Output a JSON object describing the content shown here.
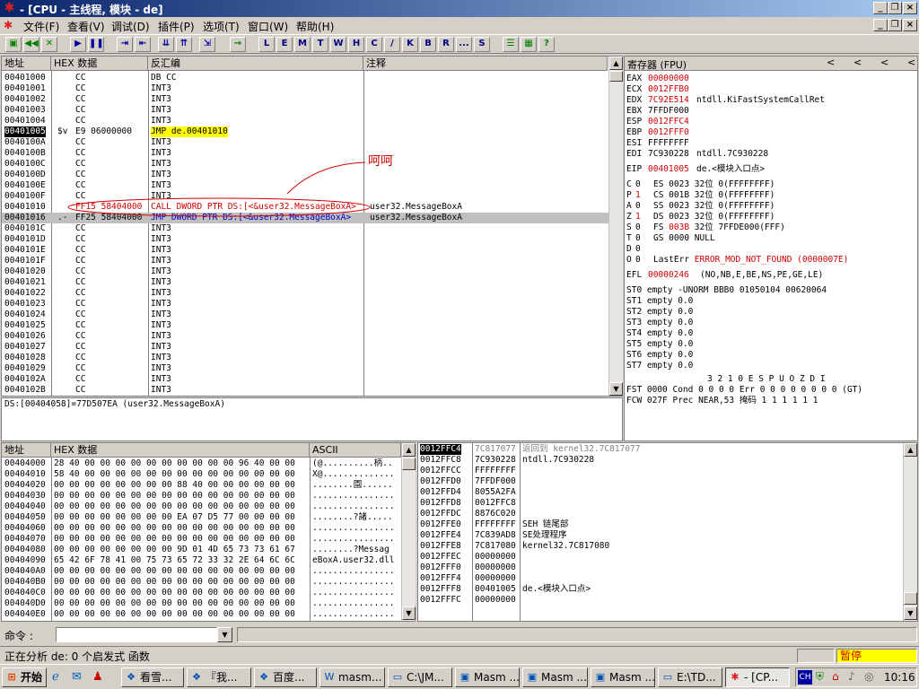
{
  "title": "- [CPU - 主线程, 模块 - de]",
  "menu": [
    "文件(F)",
    "查看(V)",
    "调试(D)",
    "插件(P)",
    "选项(T)",
    "窗口(W)",
    "帮助(H)"
  ],
  "toolbar_letters": [
    "L",
    "E",
    "M",
    "T",
    "W",
    "H",
    "C",
    "/",
    "K",
    "B",
    "R",
    "...",
    "S"
  ],
  "disasm": {
    "headers": [
      "地址",
      "HEX 数据",
      "反汇编",
      "注释"
    ],
    "rows": [
      {
        "addr": "00401000",
        "hex": "CC",
        "asm": "DB CC",
        "cmt": ""
      },
      {
        "addr": "00401001",
        "hex": "CC",
        "asm": "INT3",
        "cmt": ""
      },
      {
        "addr": "00401002",
        "hex": "CC",
        "asm": "INT3",
        "cmt": ""
      },
      {
        "addr": "00401003",
        "hex": "CC",
        "asm": "INT3",
        "cmt": ""
      },
      {
        "addr": "00401004",
        "hex": "CC",
        "asm": "INT3",
        "cmt": ""
      },
      {
        "addr": "00401005",
        "mark": "$v",
        "hex": "E9 06000000",
        "asm": "JMP de.00401010",
        "cmt": ""
      },
      {
        "addr": "0040100A",
        "hex": "CC",
        "asm": "INT3",
        "cmt": ""
      },
      {
        "addr": "0040100B",
        "hex": "CC",
        "asm": "INT3",
        "cmt": ""
      },
      {
        "addr": "0040100C",
        "hex": "CC",
        "asm": "INT3",
        "cmt": ""
      },
      {
        "addr": "0040100D",
        "hex": "CC",
        "asm": "INT3",
        "cmt": ""
      },
      {
        "addr": "0040100E",
        "hex": "CC",
        "asm": "INT3",
        "cmt": ""
      },
      {
        "addr": "0040100F",
        "hex": "CC",
        "asm": "INT3",
        "cmt": ""
      },
      {
        "addr": "00401010",
        "hex": "FF15 58404000",
        "asm": "CALL DWORD PTR DS:[<&user32.MessageBoxA>",
        "cmt": "user32.MessageBoxA"
      },
      {
        "addr": "00401016",
        "mark": ".-",
        "hex": "FF25 58404000",
        "asm": "JMP DWORD PTR DS:[<&user32.MessageBoxA>",
        "cmt": "user32.MessageBoxA"
      },
      {
        "addr": "0040101C",
        "hex": "CC",
        "asm": "INT3",
        "cmt": ""
      },
      {
        "addr": "0040101D",
        "hex": "CC",
        "asm": "INT3",
        "cmt": ""
      },
      {
        "addr": "0040101E",
        "hex": "CC",
        "asm": "INT3",
        "cmt": ""
      },
      {
        "addr": "0040101F",
        "hex": "CC",
        "asm": "INT3",
        "cmt": ""
      },
      {
        "addr": "00401020",
        "hex": "CC",
        "asm": "INT3",
        "cmt": ""
      },
      {
        "addr": "00401021",
        "hex": "CC",
        "asm": "INT3",
        "cmt": ""
      },
      {
        "addr": "00401022",
        "hex": "CC",
        "asm": "INT3",
        "cmt": ""
      },
      {
        "addr": "00401023",
        "hex": "CC",
        "asm": "INT3",
        "cmt": ""
      },
      {
        "addr": "00401024",
        "hex": "CC",
        "asm": "INT3",
        "cmt": ""
      },
      {
        "addr": "00401025",
        "hex": "CC",
        "asm": "INT3",
        "cmt": ""
      },
      {
        "addr": "00401026",
        "hex": "CC",
        "asm": "INT3",
        "cmt": ""
      },
      {
        "addr": "00401027",
        "hex": "CC",
        "asm": "INT3",
        "cmt": ""
      },
      {
        "addr": "00401028",
        "hex": "CC",
        "asm": "INT3",
        "cmt": ""
      },
      {
        "addr": "00401029",
        "hex": "CC",
        "asm": "INT3",
        "cmt": ""
      },
      {
        "addr": "0040102A",
        "hex": "CC",
        "asm": "INT3",
        "cmt": ""
      },
      {
        "addr": "0040102B",
        "hex": "CC",
        "asm": "INT3",
        "cmt": ""
      }
    ],
    "annotation": "呵呵",
    "info_line": "DS:[00404058]=77D507EA (user32.MessageBoxA)"
  },
  "registers": {
    "header": "寄存器 (FPU)",
    "nav": [
      "<",
      "<",
      "<",
      "<"
    ],
    "lines": [
      {
        "name": "EAX",
        "value": "00000000",
        "comment": "",
        "red": true
      },
      {
        "name": "ECX",
        "value": "0012FFB0",
        "comment": "",
        "red": true
      },
      {
        "name": "EDX",
        "value": "7C92E514",
        "comment": "ntdll.KiFastSystemCallRet",
        "red": true
      },
      {
        "name": "EBX",
        "value": "7FFDF000",
        "comment": "",
        "red": false
      },
      {
        "name": "ESP",
        "value": "0012FFC4",
        "comment": "",
        "red": true
      },
      {
        "name": "EBP",
        "value": "0012FFF0",
        "comment": "",
        "red": true
      },
      {
        "name": "ESI",
        "value": "FFFFFFFF",
        "comment": "",
        "red": false
      },
      {
        "name": "EDI",
        "value": "7C930228",
        "comment": "ntdll.7C930228",
        "red": false
      }
    ],
    "eip": {
      "name": "EIP",
      "value": "00401005",
      "comment": "de.<模块入口点>"
    },
    "flags": [
      {
        "f": "C",
        "v": "0",
        "seg": "ES 0023 32位 0(FFFFFFFF)",
        "red": false
      },
      {
        "f": "P",
        "v": "1",
        "seg": "CS 001B 32位 0(FFFFFFFF)",
        "red": true
      },
      {
        "f": "A",
        "v": "0",
        "seg": "SS 0023 32位 0(FFFFFFFF)",
        "red": false
      },
      {
        "f": "Z",
        "v": "1",
        "seg": "DS 0023 32位 0(FFFFFFFF)",
        "red": true
      },
      {
        "f": "S",
        "v": "0",
        "seg": "FS 003B 32位 7FFDE000(FFF)",
        "red": false
      },
      {
        "f": "T",
        "v": "0",
        "seg": "GS 0000 NULL",
        "red": false
      },
      {
        "f": "D",
        "v": "0",
        "seg": "",
        "red": false
      },
      {
        "f": "O",
        "v": "0",
        "seg": "LastErr ERROR_MOD_NOT_FOUND (0000007E)",
        "red": false
      }
    ],
    "efl": {
      "name": "EFL",
      "value": "00000246",
      "comment": "(NO,NB,E,BE,NS,PE,GE,LE)"
    },
    "fpu": [
      "ST0 empty -UNORM BBB0 01050104 00620064",
      "ST1 empty 0.0",
      "ST2 empty 0.0",
      "ST3 empty 0.0",
      "ST4 empty 0.0",
      "ST5 empty 0.0",
      "ST6 empty 0.0",
      "ST7 empty 0.0"
    ],
    "fpu_bits_hdr": "3 2 1 0      E S P U O Z D I",
    "fst": "FST 0000  Cond 0 0 0 0  Err 0 0 0 0 0 0 0 0  (GT)",
    "fcw": "FCW 027F  Prec NEAR,53  掩码    1 1 1 1 1 1"
  },
  "dump": {
    "headers": [
      "地址",
      "HEX 数据",
      "ASCII"
    ],
    "rows": [
      {
        "addr": "00404000",
        "hex": "28 40 00 00 00 00 00 00 00 00 00 00 96 40 00 00",
        "ascii": "(@..........柄.."
      },
      {
        "addr": "00404010",
        "hex": "58 40 00 00 00 00 00 00 00 00 00 00 00 00 00 00",
        "ascii": "X@.............."
      },
      {
        "addr": "00404020",
        "hex": "00 00 00 00 00 00 00 00 88 40 00 00 00 00 00 00",
        "ascii": "........園......"
      },
      {
        "addr": "00404030",
        "hex": "00 00 00 00 00 00 00 00 00 00 00 00 00 00 00 00",
        "ascii": "................"
      },
      {
        "addr": "00404040",
        "hex": "00 00 00 00 00 00 00 00 00 00 00 00 00 00 00 00",
        "ascii": "................"
      },
      {
        "addr": "00404050",
        "hex": "00 00 00 00 00 00 00 00 EA 07 D5 77 00 00 00 00",
        "ascii": "........?諸....."
      },
      {
        "addr": "00404060",
        "hex": "00 00 00 00 00 00 00 00 00 00 00 00 00 00 00 00",
        "ascii": "................"
      },
      {
        "addr": "00404070",
        "hex": "00 00 00 00 00 00 00 00 00 00 00 00 00 00 00 00",
        "ascii": "................"
      },
      {
        "addr": "00404080",
        "hex": "00 00 00 00 00 00 00 00 9D 01 4D 65 73 73 61 67",
        "ascii": "........?Messag"
      },
      {
        "addr": "00404090",
        "hex": "65 42 6F 78 41 00 75 73 65 72 33 32 2E 64 6C 6C",
        "ascii": "eBoxA.user32.dll"
      },
      {
        "addr": "004040A0",
        "hex": "00 00 00 00 00 00 00 00 00 00 00 00 00 00 00 00",
        "ascii": "................"
      },
      {
        "addr": "004040B0",
        "hex": "00 00 00 00 00 00 00 00 00 00 00 00 00 00 00 00",
        "ascii": "................"
      },
      {
        "addr": "004040C0",
        "hex": "00 00 00 00 00 00 00 00 00 00 00 00 00 00 00 00",
        "ascii": "................"
      },
      {
        "addr": "004040D0",
        "hex": "00 00 00 00 00 00 00 00 00 00 00 00 00 00 00 00",
        "ascii": "................"
      },
      {
        "addr": "004040E0",
        "hex": "00 00 00 00 00 00 00 00 00 00 00 00 00 00 00 00",
        "ascii": "................"
      }
    ]
  },
  "stack": {
    "rows": [
      {
        "addr": "0012FFC4",
        "val": "7C817077",
        "cmt": "返回到 kernel32.7C817077"
      },
      {
        "addr": "0012FFC8",
        "val": "7C930228",
        "cmt": "ntdll.7C930228"
      },
      {
        "addr": "0012FFCC",
        "val": "FFFFFFFF",
        "cmt": ""
      },
      {
        "addr": "0012FFD0",
        "val": "7FFDF000",
        "cmt": ""
      },
      {
        "addr": "0012FFD4",
        "val": "8055A2FA",
        "cmt": ""
      },
      {
        "addr": "0012FFD8",
        "val": "0012FFC8",
        "cmt": ""
      },
      {
        "addr": "0012FFDC",
        "val": "8876C020",
        "cmt": ""
      },
      {
        "addr": "0012FFE0",
        "val": "FFFFFFFF",
        "cmt": "SEH 链尾部"
      },
      {
        "addr": "0012FFE4",
        "val": "7C839AD8",
        "cmt": "SE处理程序"
      },
      {
        "addr": "0012FFE8",
        "val": "7C817080",
        "cmt": "kernel32.7C817080"
      },
      {
        "addr": "0012FFEC",
        "val": "00000000",
        "cmt": ""
      },
      {
        "addr": "0012FFF0",
        "val": "00000000",
        "cmt": ""
      },
      {
        "addr": "0012FFF4",
        "val": "00000000",
        "cmt": ""
      },
      {
        "addr": "0012FFF8",
        "val": "00401005",
        "cmt": "de.<模块入口点>"
      },
      {
        "addr": "0012FFFC",
        "val": "00000000",
        "cmt": ""
      }
    ]
  },
  "command": {
    "label": "命令 :",
    "value": ""
  },
  "status": {
    "text": "正在分析 de: 0 个启发式 函数",
    "state": "暂停"
  },
  "taskbar": {
    "start": "开始",
    "items": [
      "看雪...",
      "『我...",
      "百度...",
      "masm...",
      "C:\\JM...",
      "Masm ...",
      "Masm ...",
      "Masm ...",
      "E:\\TD...",
      "- [CP..."
    ],
    "clock": "10:16",
    "tray_ime": "CH"
  }
}
